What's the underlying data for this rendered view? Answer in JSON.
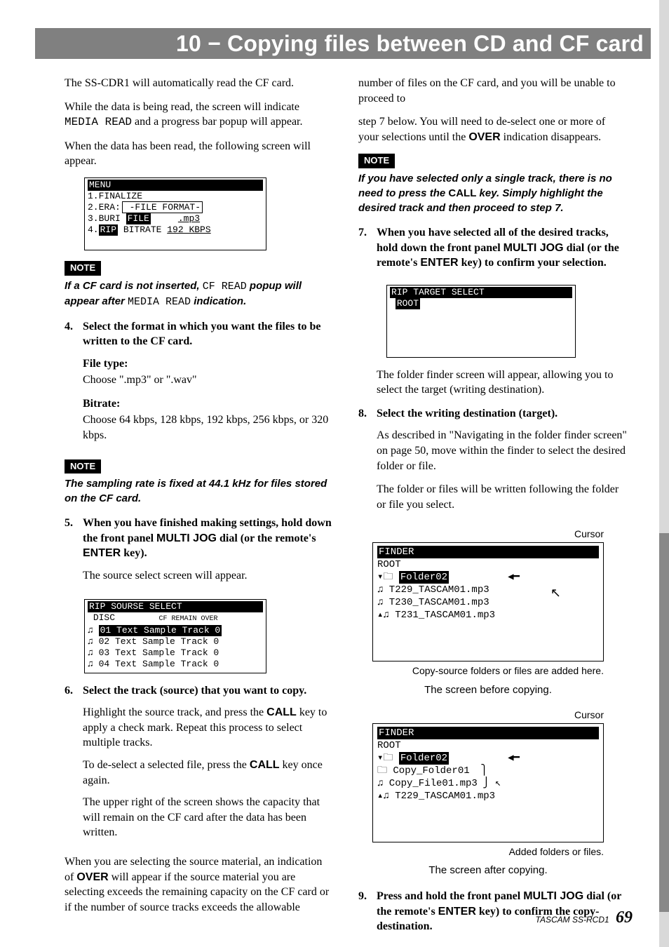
{
  "banner": "10 − Copying files between CD and CF card",
  "left": {
    "p1": "The SS-CDR1 will automatically read the CF card.",
    "p2a": "While the data is being read, the screen will indicate ",
    "p2b": "MEDIA READ",
    "p2c": " and a progress bar popup will appear.",
    "p3": "When the data has been read, the following screen will appear.",
    "screen1": {
      "title": "MENU",
      "l1": "1.FINALIZE",
      "l2a": "2.ERA:",
      "l2b": " -FILE FORMAT-",
      "l3a": "3.BURI",
      "l3b": "FILE",
      "l3c": ".mp3",
      "l4a": "4.",
      "l4b": "RIP",
      "l4c": " BITRATE  ",
      "l4d": "192 KBPS"
    },
    "note1_badge": "NOTE",
    "note1_text_a": "If a CF card is not inserted, ",
    "note1_text_b": "CF READ",
    "note1_text_c": " popup will appear after ",
    "note1_text_d": "MEDIA READ",
    "note1_text_e": " indication.",
    "step4_num": "4.",
    "step4_head": "Select the format in which you want the files to be written to the CF card.",
    "step4_ft_label": "File type:",
    "step4_ft_body": "Choose \".mp3\" or \".wav\"",
    "step4_br_label": "Bitrate:",
    "step4_br_body": "Choose 64 kbps, 128 kbps, 192 kbps, 256 kbps, or 320 kbps.",
    "note2_badge": "NOTE",
    "note2_text": "The sampling rate is fixed at 44.1 kHz for files stored on the CF card.",
    "step5_num": "5.",
    "step5_head_a": "When you have finished making settings, hold down the front panel ",
    "step5_head_b": "MULTI JOG",
    "step5_head_c": " dial (or the remote's ",
    "step5_head_d": "ENTER",
    "step5_head_e": " key).",
    "step5_body": "The source select screen will appear.",
    "screen2": {
      "title": "RIP SOURSE SELECT",
      "hdr_a": "DISC",
      "hdr_b": "CF REMAIN OVER",
      "r1": "♫ 01 Text Sample Track 0",
      "r2": "♫ 02 Text Sample Track 0",
      "r3": "♫ 03 Text Sample Track 0",
      "r4": "♫ 04 Text Sample Track 0"
    },
    "step6_num": "6.",
    "step6_head": "Select the track (source) that you want to copy.",
    "step6_p1a": "Highlight the source track, and press the ",
    "step6_p1b": "CALL",
    "step6_p1c": " key to apply a check mark. Repeat this process to select multiple tracks.",
    "step6_p2a": "To de-select a selected file, press the ",
    "step6_p2b": "CALL",
    "step6_p2c": " key once again.",
    "step6_p3": "The upper right of the screen shows the capacity that will remain on the CF card after the data has been written.",
    "lpara_a": "When you are selecting the source material, an indication of ",
    "lpara_b": "OVER",
    "lpara_c": " will appear if the source material you are selecting exceeds the remaining capacity on the CF card or if the number of source tracks exceeds the allowable number of files on the CF card, and you will be unable to proceed to"
  },
  "right": {
    "p1a": "step 7 below. You will need to de-select one or more of your selections until the ",
    "p1b": "OVER",
    "p1c": " indication disappears.",
    "note3_badge": "NOTE",
    "note3_a": "If you have selected only a single track, there is no need to press the ",
    "note3_b": "CALL",
    "note3_c": " key. Simply highlight the desired track and then proceed to step 7.",
    "step7_num": "7.",
    "step7_head_a": "When you have selected all of the desired tracks, hold down the front panel ",
    "step7_head_b": "MULTI JOG",
    "step7_head_c": " dial (or the remote's ",
    "step7_head_d": "ENTER",
    "step7_head_e": " key) to confirm your selection.",
    "screen3": {
      "title": "RIP TARGET SELECT",
      "l1": "ROOT"
    },
    "step7_body": "The folder finder screen will appear, allowing you to select the target (writing destination).",
    "step8_num": "8.",
    "step8_head": "Select the writing destination (target).",
    "step8_p1": "As described in \"Navigating in the folder finder screen\" on page 50, move within the finder to select the desired folder or file.",
    "step8_p2": "The folder or files will be written following the folder or file you select.",
    "fig1": {
      "cursor": "Cursor",
      "title": "FINDER",
      "l1": " ROOT",
      "l2": "▾🗀 Folder02",
      "l3": " ♫ T229_TASCAM01.mp3",
      "l4": " ♫ T230_TASCAM01.mp3",
      "l5": "▴♫ T231_TASCAM01.mp3",
      "label": "Copy-source folders or files are added here.",
      "caption": "The screen before copying."
    },
    "fig2": {
      "cursor": "Cursor",
      "title": "FINDER",
      "l1": " ROOT",
      "l2": "▾🗀 Folder02",
      "l3": " 🗀 Copy_Folder01",
      "l4": " ♫ Copy_File01.mp3",
      "l5": "▴♫ T229_TASCAM01.mp3",
      "label": "Added folders or files.",
      "caption": "The screen after copying."
    },
    "step9_num": "9.",
    "step9_head_a": "Press and hold the front panel ",
    "step9_head_b": "MULTI JOG",
    "step9_head_c": " dial (or the remote's ",
    "step9_head_d": "ENTER",
    "step9_head_e": " key) to confirm the copy-destination."
  },
  "footer": {
    "brand": "TASCAM  SS-RCD1",
    "page": "69"
  }
}
